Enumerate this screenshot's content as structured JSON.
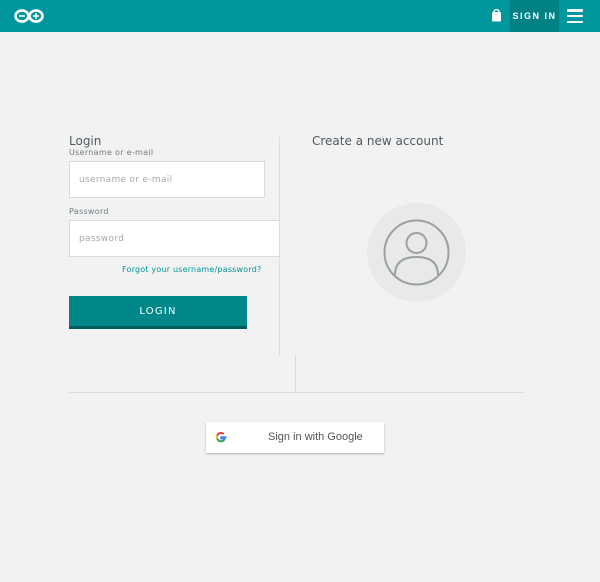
{
  "header": {
    "logo_icon": "infinity-logo-icon",
    "cart_icon": "shopping-bag-icon",
    "signin_label": "SIGN IN",
    "menu_icon": "hamburger-menu-icon",
    "bar_color": "#00979c"
  },
  "login": {
    "title": "Login",
    "username_label": "Username or e-mail",
    "username_placeholder": "username or e-mail",
    "password_label": "Password",
    "password_placeholder": "password",
    "forgot_link": "Forgot your username/password?",
    "login_button": "LOGIN"
  },
  "signup": {
    "title": "Create a new account",
    "avatar_icon": "user-avatar-icon"
  },
  "google": {
    "icon": "google-g-icon",
    "label": "Sign in with Google"
  }
}
